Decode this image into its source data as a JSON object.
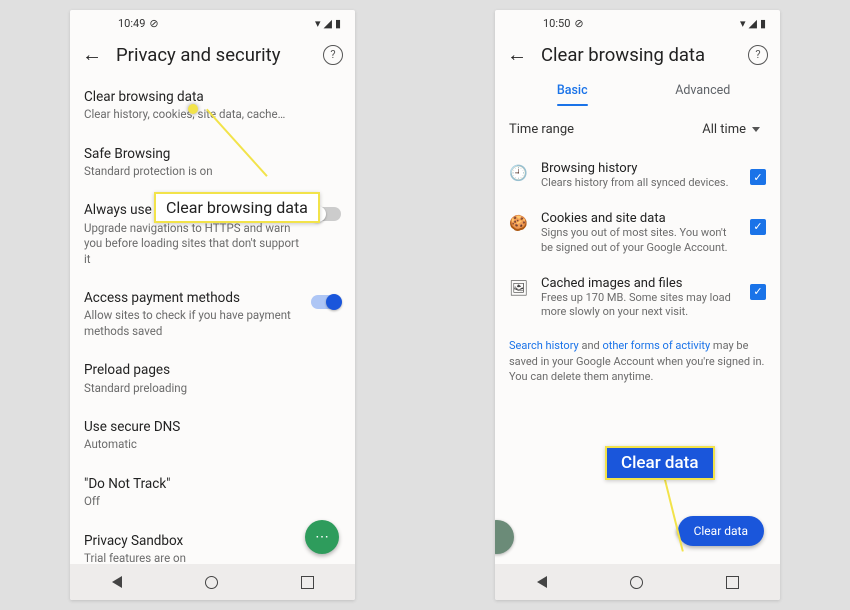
{
  "left": {
    "status": {
      "time": "10:49",
      "icon": "⊘"
    },
    "title": "Privacy and security",
    "items": [
      {
        "title": "Clear browsing data",
        "sub": "Clear history, cookies, site data, cache…"
      },
      {
        "title": "Safe Browsing",
        "sub": "Standard protection is on"
      },
      {
        "title": "Always use secure connections",
        "sub": "Upgrade navigations to HTTPS and warn you before loading sites that don't support it",
        "toggle": "off"
      },
      {
        "title": "Access payment methods",
        "sub": "Allow sites to check if you have payment methods saved",
        "toggle": "on"
      },
      {
        "title": "Preload pages",
        "sub": "Standard preloading"
      },
      {
        "title": "Use secure DNS",
        "sub": "Automatic"
      },
      {
        "title": "\"Do Not Track\"",
        "sub": "Off"
      },
      {
        "title": "Privacy Sandbox",
        "sub": "Trial features are on"
      }
    ],
    "callout": "Clear browsing data"
  },
  "right": {
    "status": {
      "time": "10:50",
      "icon": "⊘"
    },
    "title": "Clear browsing data",
    "tabs": {
      "basic": "Basic",
      "advanced": "Advanced"
    },
    "time_range": {
      "label": "Time range",
      "value": "All time"
    },
    "checks": [
      {
        "icon": "clock",
        "title": "Browsing history",
        "sub": "Clears history from all synced devices."
      },
      {
        "icon": "cookie",
        "title": "Cookies and site data",
        "sub": "Signs you out of most sites. You won't be signed out of your Google Account."
      },
      {
        "icon": "image",
        "title": "Cached images and files",
        "sub": "Frees up 170 MB. Some sites may load more slowly on your next visit."
      }
    ],
    "footer": {
      "link1": "Search history",
      "mid": " and ",
      "link2": "other forms of activity",
      "rest": " may be saved in your Google Account when you're signed in. You can delete them anytime."
    },
    "clear_btn": "Clear data",
    "callout": "Clear data"
  }
}
